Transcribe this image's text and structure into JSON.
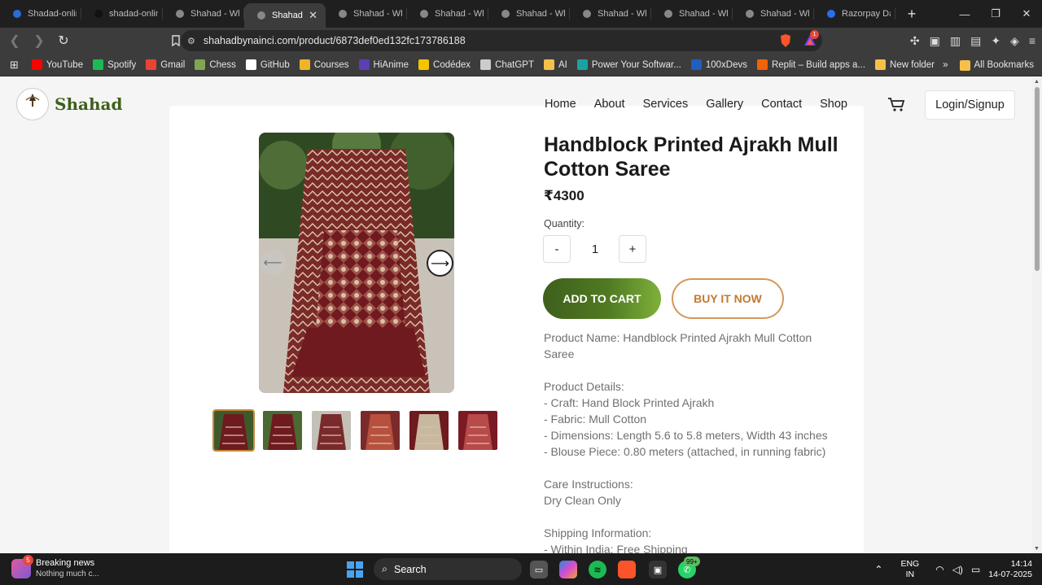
{
  "browser": {
    "tabs": [
      {
        "title": "Shadad-onlin",
        "active": false
      },
      {
        "title": "shadad-onlin",
        "active": false
      },
      {
        "title": "Shahad - Wh",
        "active": false
      },
      {
        "title": "Shahad",
        "active": true
      },
      {
        "title": "Shahad - Wh",
        "active": false
      },
      {
        "title": "Shahad - Wh",
        "active": false
      },
      {
        "title": "Shahad - Wh",
        "active": false
      },
      {
        "title": "Shahad - Wh",
        "active": false
      },
      {
        "title": "Shahad - Wh",
        "active": false
      },
      {
        "title": "Shahad - Wh",
        "active": false
      },
      {
        "title": "Razorpay Da",
        "active": false
      }
    ],
    "url": "shahadbynainci.com/product/6873def0ed132fc173786188",
    "bookmarks": [
      {
        "label": "YouTube",
        "icon": "youtube-icon",
        "color": "#ff0000"
      },
      {
        "label": "Spotify",
        "icon": "spotify-icon",
        "color": "#1db954"
      },
      {
        "label": "Gmail",
        "icon": "gmail-icon",
        "color": "#ea4335"
      },
      {
        "label": "Chess",
        "icon": "chess-icon",
        "color": "#7fa650"
      },
      {
        "label": "GitHub",
        "icon": "github-icon",
        "color": "#ffffff"
      },
      {
        "label": "Courses",
        "icon": "courses-icon",
        "color": "#f0b429"
      },
      {
        "label": "HiAnime",
        "icon": "hianime-icon",
        "color": "#5b3fb5"
      },
      {
        "label": "Codédex",
        "icon": "codedex-icon",
        "color": "#f5c400"
      },
      {
        "label": "ChatGPT",
        "icon": "chatgpt-icon",
        "color": "#cccccc"
      },
      {
        "label": "AI",
        "icon": "folder-icon",
        "color": "#f5c04a"
      },
      {
        "label": "Power Your Softwar...",
        "icon": "power-icon",
        "color": "#1aa3a3"
      },
      {
        "label": "100xDevs",
        "icon": "100xdevs-icon",
        "color": "#1f5fbf"
      },
      {
        "label": "Replit – Build apps a...",
        "icon": "replit-icon",
        "color": "#f26207"
      },
      {
        "label": "New folder",
        "icon": "folder-icon",
        "color": "#f5c04a"
      }
    ],
    "all_bookmarks": "All Bookmarks",
    "shield_badge": "1"
  },
  "site": {
    "brand": "Shahad",
    "logo_text": "Shahad",
    "nav": [
      "Home",
      "About",
      "Services",
      "Gallery",
      "Contact",
      "Shop"
    ],
    "login": "Login/Signup"
  },
  "product": {
    "title": "Handblock Printed Ajrakh Mull Cotton Saree",
    "price": "₹4300",
    "quantity_label": "Quantity:",
    "quantity": "1",
    "minus": "-",
    "plus": "+",
    "add_to_cart": "ADD TO CART",
    "buy_now": "BUY IT NOW",
    "prev_arrow": "⟵",
    "next_arrow": "⟶",
    "thumbnails": 6,
    "description": [
      "Product Name: Handblock Printed Ajrakh Mull Cotton Saree",
      "",
      "Product Details:",
      "- Craft: Hand Block Printed Ajrakh",
      "- Fabric: Mull Cotton",
      "- Dimensions: Length 5.6 to 5.8 meters, Width 43 inches",
      "- Blouse Piece: 0.80 meters (attached, in running fabric)",
      "",
      "Care Instructions:",
      "Dry Clean Only",
      "",
      "Shipping Information:",
      "- Within India: Free Shipping"
    ]
  },
  "taskbar": {
    "news_badge": "5",
    "news_title": "Breaking news",
    "news_sub": "Nothing much c...",
    "search": "Search",
    "whatsapp_badge": "99+",
    "lang1": "ENG",
    "lang2": "IN",
    "time": "14:14",
    "date": "14-07-2025"
  },
  "colors": {
    "brand_green": "#3e5f1d",
    "cart_button_start": "#3f5f1c",
    "cart_button_end": "#7fb03b",
    "buy_now_border": "#d59758",
    "buy_now_text": "#c27a31"
  }
}
